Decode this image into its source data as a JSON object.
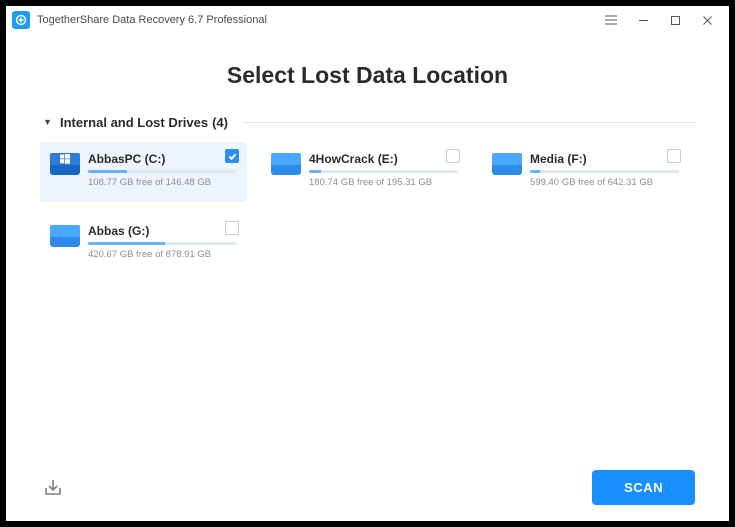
{
  "titlebar": {
    "title": "TogetherShare Data Recovery 6.7 Professional"
  },
  "page": {
    "title": "Select Lost Data Location"
  },
  "section": {
    "label_prefix": "Internal and Lost Drives",
    "count_label": "(4)"
  },
  "drives": [
    {
      "name": "AbbasPC (C:)",
      "free_text": "108.77 GB free of 146.48 GB",
      "used_pct": 26,
      "selected": true,
      "os": true
    },
    {
      "name": "4HowCrack (E:)",
      "free_text": "180.74 GB free of 195.31 GB",
      "used_pct": 8,
      "selected": false,
      "os": false
    },
    {
      "name": "Media (F:)",
      "free_text": "599.40 GB free of 642.31 GB",
      "used_pct": 7,
      "selected": false,
      "os": false
    },
    {
      "name": "Abbas (G:)",
      "free_text": "420.67 GB free of 878.91 GB",
      "used_pct": 52,
      "selected": false,
      "os": false
    }
  ],
  "footer": {
    "scan_label": "SCAN"
  }
}
